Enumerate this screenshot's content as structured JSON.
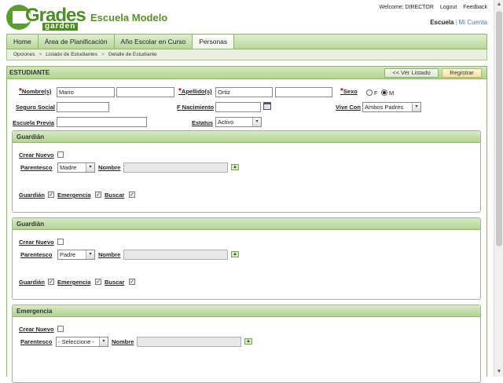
{
  "header": {
    "logo_word": "Grades",
    "logo_sub": "garden",
    "school_name": "Escuela Modelo",
    "welcome": "Welcome: DIRECTOR",
    "logout": "Logout",
    "feedback": "Feedback",
    "context": "Escuela",
    "separator": "|",
    "my_account": "Mi Cuenta"
  },
  "nav": {
    "tabs": [
      {
        "label": "Home"
      },
      {
        "label": "Área de Planificación"
      },
      {
        "label": "Año Escolar en Curso"
      },
      {
        "label": "Personas"
      }
    ],
    "active_tab": "Personas"
  },
  "breadcrumb": {
    "items": [
      "Opciones",
      "Listado de Estudiantes",
      "Detalle de Estudiante"
    ],
    "separator": ">"
  },
  "panel": {
    "title": "ESTUDIANTE",
    "back_button": "<< Ver Listado",
    "save_button": "Registrar"
  },
  "form": {
    "required_mark": "*",
    "nombres_label": "Nombre(s)",
    "nombres_value": "Mario",
    "nombres2_value": "",
    "apellidos_label": "Apellido(s)",
    "apellidos_value": "Ortiz",
    "apellidos2_value": "",
    "sexo_label": "Sexo",
    "sexo_f": "F",
    "sexo_m": "M",
    "sexo_selected": "M",
    "seguro_label": "Seguro Social",
    "seguro_value": "",
    "nacimiento_label": "F Nacimiento",
    "nacimiento_value": "",
    "vive_label": "Vive Con",
    "vive_value": "Ambos Padres",
    "escuela_label": "Escuela Previa",
    "escuela_value": "",
    "estatus_label": "Estatus",
    "estatus_value": "Activo"
  },
  "guardian1": {
    "title": "Guardián",
    "crear_label": "Crear Nuevo",
    "parentesco_label": "Parentesco",
    "parentesco_value": "Madre",
    "nombre_label": "Nombre",
    "nombre_value": "",
    "guardian_label": "Guardián",
    "emergencia_label": "Emergencia",
    "buscar_label": "Buscar",
    "check_mark": "✓"
  },
  "guardian2": {
    "title": "Guardián",
    "crear_label": "Crear Nuevo",
    "parentesco_label": "Parentesco",
    "parentesco_value": "Padre",
    "nombre_label": "Nombre",
    "nombre_value": "",
    "guardian_label": "Guardián",
    "emergencia_label": "Emergencia",
    "buscar_label": "Buscar",
    "check_mark": "✓"
  },
  "emergencia": {
    "title": "Emergencia",
    "crear_label": "Crear Nuevo",
    "parentesco_label": "Parentesco",
    "parentesco_value": "- Seleccione -",
    "nombre_label": "Nombre",
    "nombre_value": ""
  },
  "icons": {
    "dropdown": "▾",
    "up_arrow": "▲",
    "calendar": "calendar-icon",
    "scroll_up": "▲",
    "scroll_down": "▼"
  },
  "colors": {
    "brand_green": "#4e8d25",
    "header_green": "#b9d89c",
    "required_red": "#cc0000"
  }
}
